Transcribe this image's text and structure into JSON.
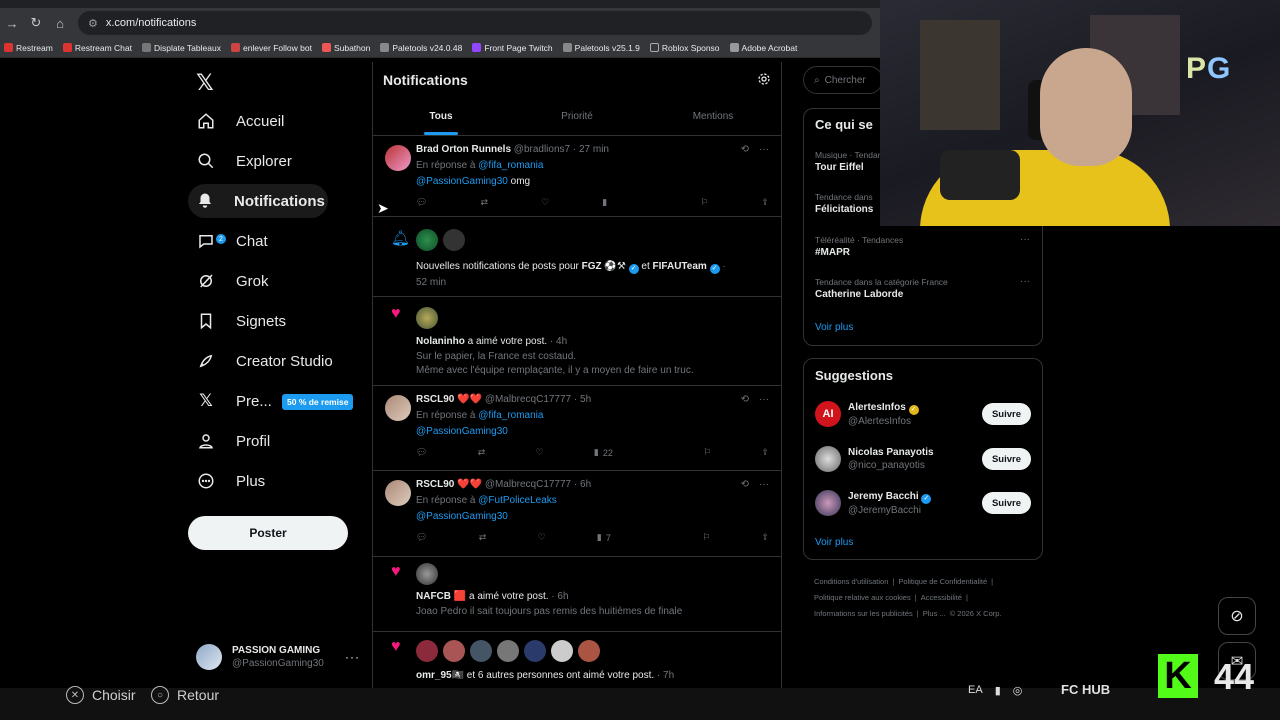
{
  "browser": {
    "url": "x.com/notifications",
    "bookmarks": [
      "Restream",
      "Restream Chat",
      "Displate Tableaux",
      "enlever Follow bot",
      "Subathon",
      "Paletools v24.0.48",
      "Front Page Twitch",
      "Paletools v25.1.9",
      "Roblox Sponso",
      "Adobe Acrobat"
    ]
  },
  "sidebar": {
    "items": [
      {
        "label": "Accueil",
        "icon": "home-icon"
      },
      {
        "label": "Explorer",
        "icon": "search-icon"
      },
      {
        "label": "Notifications",
        "icon": "bell-icon"
      },
      {
        "label": "Chat",
        "icon": "chat-icon"
      },
      {
        "label": "Grok",
        "icon": "grok-icon"
      },
      {
        "label": "Signets",
        "icon": "bookmark-icon"
      },
      {
        "label": "Creator Studio",
        "icon": "rocket-icon"
      },
      {
        "label": "Pre...",
        "icon": "x-premium-icon"
      },
      {
        "label": "Profil",
        "icon": "person-icon"
      },
      {
        "label": "Plus",
        "icon": "more-circle-icon"
      }
    ],
    "chat_badge": "2",
    "promo_badge": "50 % de remise",
    "post_label": "Poster",
    "account": {
      "name": "PASSION GAMING",
      "handle": "@PassionGaming30"
    }
  },
  "main": {
    "title": "Notifications",
    "tabs": [
      "Tous",
      "Priorité",
      "Mentions"
    ],
    "reply1": {
      "name": "Brad Orton Runnels",
      "meta": "@bradlions7 · 27 min",
      "reply_prefix": "En réponse à",
      "reply_to": "@fifa_romania",
      "mention": "@PassionGaming30",
      "text": " omg"
    },
    "notify": {
      "text_prefix": "Nouvelles notifications de posts pour",
      "name1": "FGZ ⚽⚒",
      "connector": "et",
      "name2": "FIFAUTeam",
      "time": "52 min"
    },
    "like1": {
      "name": "Nolaninho",
      "action": " a aimé votre post.",
      "time": " · 4h",
      "line1": "Sur le papier, la France est costaud.",
      "line2": "Même avec l'équipe remplaçante, il y a moyen de faire un truc."
    },
    "reply2": {
      "name": "RSCL90 ❤️❤️",
      "meta": "@MalbrecqC17777 · 5h",
      "reply_prefix": "En réponse à",
      "reply_to": "@fifa_romania",
      "mention": "@PassionGaming30",
      "views": "22"
    },
    "reply3": {
      "name": "RSCL90 ❤️❤️",
      "meta": "@MalbrecqC17777 · 6h",
      "reply_prefix": "En réponse à",
      "reply_to": "@FutPoliceLeaks",
      "mention": "@PassionGaming30",
      "views": "7"
    },
    "like2": {
      "name": "NAFCB 🟥",
      "action": " a aimé votre post.",
      "time": " · 6h",
      "line1": "Joao Pedro il sait toujours pas remis des huitièmes de finale"
    },
    "like3": {
      "name": "omr_95🏴‍☠️",
      "action": " et 6 autres personnes ont aimé votre post.",
      "time": " · 7h"
    }
  },
  "right": {
    "search_placeholder": "Chercher",
    "trends_title": "Ce qui se",
    "trends": [
      {
        "category": "Musique · Tendances",
        "name": "Tour Eiffel"
      },
      {
        "category": "Tendance dans",
        "name": "Félicitations"
      },
      {
        "category": "Téléréalité · Tendances",
        "name": "#MAPR"
      },
      {
        "category": "Tendance dans la catégorie France",
        "name": "Catherine Laborde"
      }
    ],
    "see_more": "Voir plus",
    "suggestions_title": "Suggestions",
    "suggestions": [
      {
        "name": "AlertesInfos",
        "handle": "@AlertesInfos"
      },
      {
        "name": "Nicolas Panayotis",
        "handle": "@nico_panayotis"
      },
      {
        "name": "Jeremy Bacchi",
        "handle": "@JeremyBacchi"
      }
    ],
    "follow_label": "Suivre",
    "footer": [
      "Conditions d'utilisation",
      "|",
      "Politique de Confidentialité",
      "|",
      "Politique relative aux cookies",
      "|",
      "Accessibilité",
      "|",
      "Informations sur les publicités",
      "|",
      "Plus ...",
      "© 2026 X Corp."
    ]
  },
  "overlay": {
    "cam_logo_p": "P",
    "cam_logo_g": "G",
    "hint_choose": "Choisir",
    "hint_back": "Retour",
    "fc_hub": "FC HUB",
    "kick_logo": "K",
    "kick_count": "44"
  },
  "colors": {
    "accent": "#1d9bf0",
    "like": "#f91880",
    "kick": "#53fc18"
  }
}
